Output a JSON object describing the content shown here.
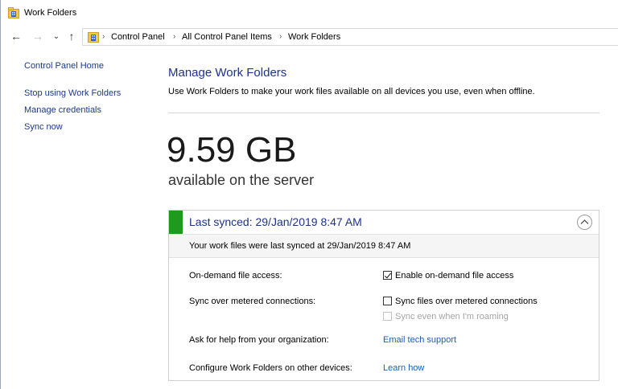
{
  "window": {
    "title": "Work Folders"
  },
  "nav": {
    "back": "←",
    "forward": "→",
    "recent": "⌄",
    "up": "↑"
  },
  "breadcrumb": {
    "items": [
      "Control Panel",
      "All Control Panel Items",
      "Work Folders"
    ],
    "separator": "›"
  },
  "left_pane": {
    "home": "Control Panel Home",
    "links": [
      "Stop using Work Folders",
      "Manage credentials",
      "Sync now"
    ]
  },
  "main": {
    "heading": "Manage Work Folders",
    "subtitle": "Use Work Folders to make your work files available on all devices you use, even when offline.",
    "storage_value": "9.59 GB",
    "storage_caption": "available on the server"
  },
  "sync_panel": {
    "status_color": "#1f9a1f",
    "title": "Last synced: 29/Jan/2019 8:47 AM",
    "detail": "Your work files were last synced at 29/Jan/2019 8:47 AM",
    "rows": {
      "on_demand_label": "On-demand file access:",
      "on_demand_option": "Enable on-demand file access",
      "on_demand_checked": true,
      "metered_label": "Sync over metered connections:",
      "metered_option": "Sync files over metered connections",
      "metered_checked": false,
      "roaming_option": "Sync even when I'm roaming",
      "roaming_checked": false,
      "help_label": "Ask for help from your organization:",
      "help_link": "Email tech support",
      "configure_label": "Configure Work Folders on other devices:",
      "configure_link": "Learn how"
    }
  }
}
